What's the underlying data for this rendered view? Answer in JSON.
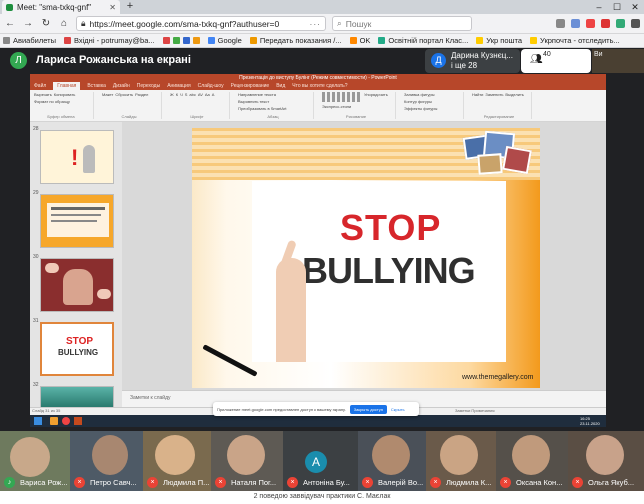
{
  "browser": {
    "tab_title": "Meet: \"sma-txkq-gnf\"",
    "url": "https://meet.google.com/sma-txkq-gnf?authuser=0",
    "search_placeholder": "Пошук",
    "bookmarks": [
      "Авиабилеты",
      "Вхідні - potrumay@ba...",
      "Google",
      "Передать показания /...",
      "OK",
      "Освітній портал Клас...",
      "Укр пошта",
      "Укрпочта - отследить..."
    ]
  },
  "meet": {
    "presenter_initial": "Л",
    "presenter_title": "Лариса Рожанська на екрані",
    "participant_initial": "Д",
    "participant_name_1": "Дарина Кузнєц...",
    "participant_name_2": "і ще 28",
    "people_count": "40",
    "self_label": "Ви"
  },
  "ppt": {
    "window_title": "Презентація до виступу Булінг (Режим совместимости) - PowerPoint",
    "tabs": [
      "Файл",
      "Главная",
      "Вставка",
      "Дизайн",
      "Переходы",
      "Анимация",
      "Слайд-шоу",
      "Рецензирование",
      "Вид",
      "Что вы хотите сделать?"
    ],
    "ribbon_groups": [
      {
        "items": [
          "Вырезать",
          "Копировать",
          "Формат по образцу"
        ],
        "label": "Буфер обмена"
      },
      {
        "items": [
          "Макет",
          "Сбросить",
          "Раздел"
        ],
        "label": "Слайды"
      },
      {
        "items": [
          "Ж",
          "К",
          "Ч",
          "S",
          "abc",
          "AV",
          "Aa",
          "A"
        ],
        "label": "Шрифт"
      },
      {
        "items": [
          "Направление текста",
          "Выровнять текст",
          "Преобразовать в SmartArt"
        ],
        "label": "Абзац"
      },
      {
        "items": [
          "Упорядочить",
          "Экспресс-стили"
        ],
        "label": "Рисование"
      },
      {
        "items": [
          "Заливка фигуры",
          "Контур фигуры",
          "Эффекты фигуры"
        ],
        "label": ""
      },
      {
        "items": [
          "Найти",
          "Заменить",
          "Выделить"
        ],
        "label": "Редактирование"
      }
    ],
    "thumb_numbers": [
      "28",
      "29",
      "30",
      "31",
      "32"
    ],
    "slide": {
      "stop": "STOP",
      "bullying": "BULLYING",
      "url": "www.themegallery.com"
    },
    "notes_placeholder": "Заметки к слайду",
    "status_left": "Слайд 31 из 35",
    "status_right": "Заметки    Примечания",
    "clock_time": "16:25",
    "clock_date": "23.11.2020"
  },
  "notice": {
    "text": "Приложение meet.google.com предоставлен доступ к вашему экрану.",
    "stop_button": "Закрыть доступ",
    "hide_button": "Скрыть"
  },
  "participants": [
    {
      "name": "Вариса Рож..."
    },
    {
      "name": "Петро Савч..."
    },
    {
      "name": "Людмила П..."
    },
    {
      "name": "Наталя Пог..."
    },
    {
      "name": "Антоніна Бу...",
      "initial": "А"
    },
    {
      "name": "Валерій Во..."
    },
    {
      "name": "Людмила К..."
    },
    {
      "name": "Оксана Кон..."
    },
    {
      "name": "Ольга Якуб..."
    }
  ],
  "bottom_caption": "2 поведою заввідувач практики С. Маєлак"
}
